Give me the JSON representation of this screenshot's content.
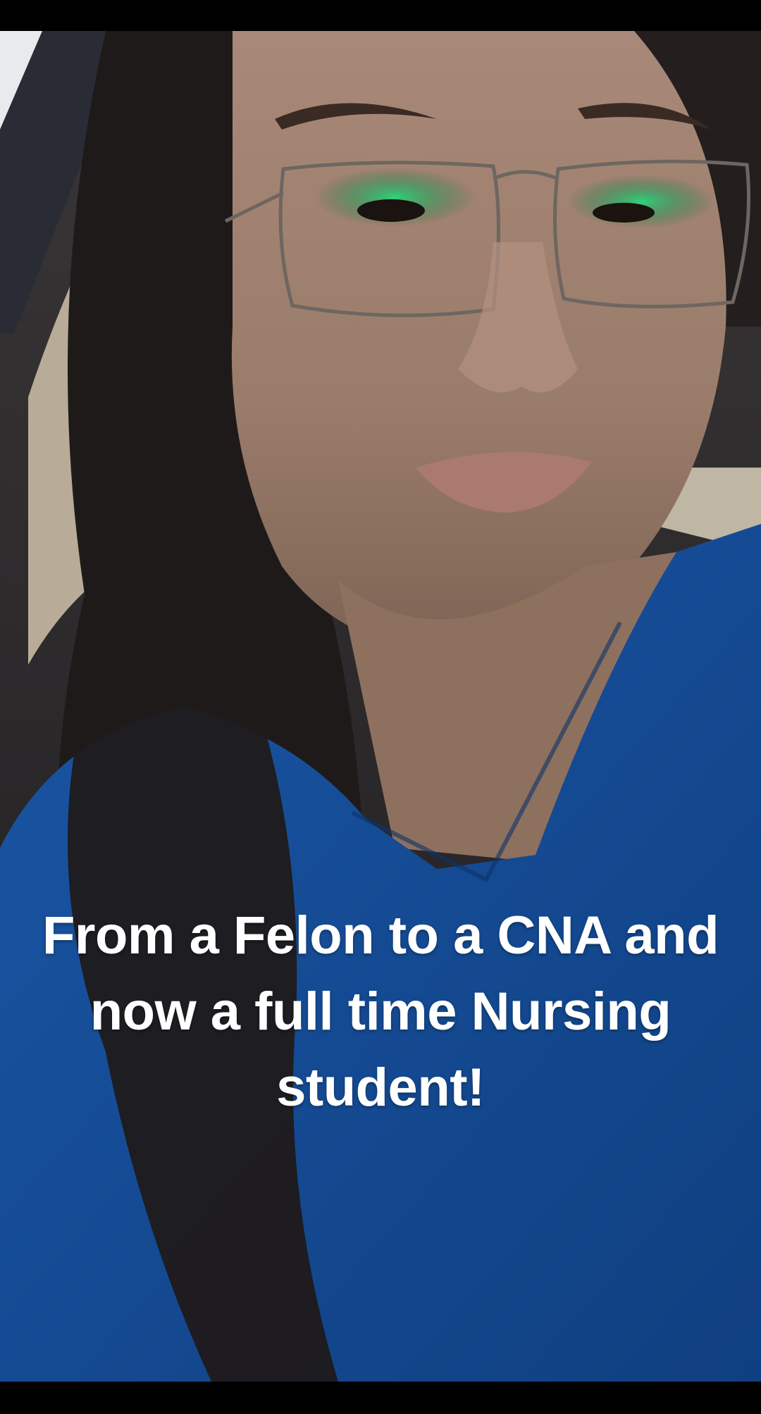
{
  "caption": {
    "text": "From a Felon to a CNA and now a full time Nursing student!",
    "color": "#ffffff"
  },
  "photo": {
    "subject": "selfie",
    "colors": {
      "scrubs": "#154d9a",
      "hair": "#1f1a1a",
      "skin": "#a98a78",
      "eyeshadow": "#1ea35a",
      "background": "#2c2a2c"
    }
  }
}
